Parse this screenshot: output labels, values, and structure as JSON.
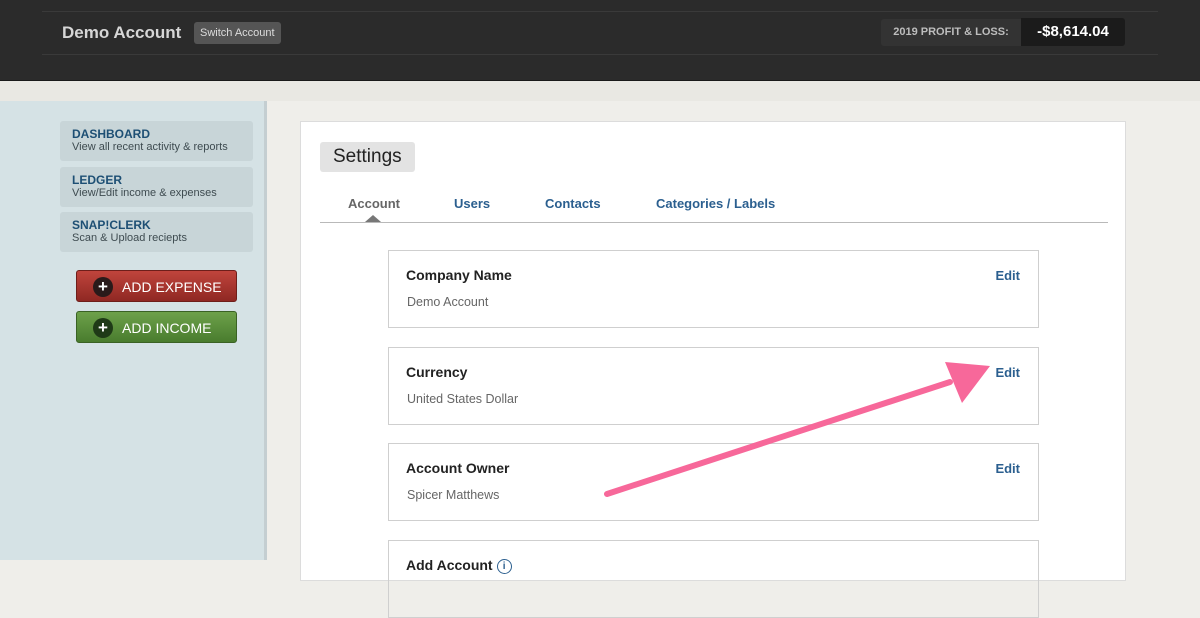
{
  "header": {
    "account_name": "Demo Account",
    "switch_label": "Switch Account",
    "pl_label": "2019 PROFIT & LOSS:",
    "pl_value": "-$8,614.04"
  },
  "sidebar": {
    "items": [
      {
        "title": "DASHBOARD",
        "subtitle": "View all recent activity & reports"
      },
      {
        "title": "LEDGER",
        "subtitle": "View/Edit income & expenses"
      },
      {
        "title": "SNAP!CLERK",
        "subtitle": "Scan & Upload reciepts"
      }
    ],
    "add_expense": "ADD EXPENSE",
    "add_income": "ADD INCOME"
  },
  "main": {
    "title": "Settings",
    "tabs": [
      {
        "label": "Account",
        "active": true
      },
      {
        "label": "Users"
      },
      {
        "label": "Contacts"
      },
      {
        "label": "Categories / Labels"
      }
    ],
    "cards": [
      {
        "label": "Company Name",
        "value": "Demo Account",
        "edit": "Edit"
      },
      {
        "label": "Currency",
        "value": "United States Dollar",
        "edit": "Edit"
      },
      {
        "label": "Account Owner",
        "value": "Spicer Matthews",
        "edit": "Edit"
      },
      {
        "label": "Add Account"
      }
    ]
  },
  "colors": {
    "topbar": "#2b2b2b",
    "link_blue": "#2b5f8f",
    "annotation_pink": "#f7689a",
    "expense_red": "#a8332d",
    "income_green": "#5a8e3a"
  },
  "icons": {
    "plus": "plus-circle-icon",
    "info": "info-icon",
    "caret": "tab-caret-icon"
  }
}
